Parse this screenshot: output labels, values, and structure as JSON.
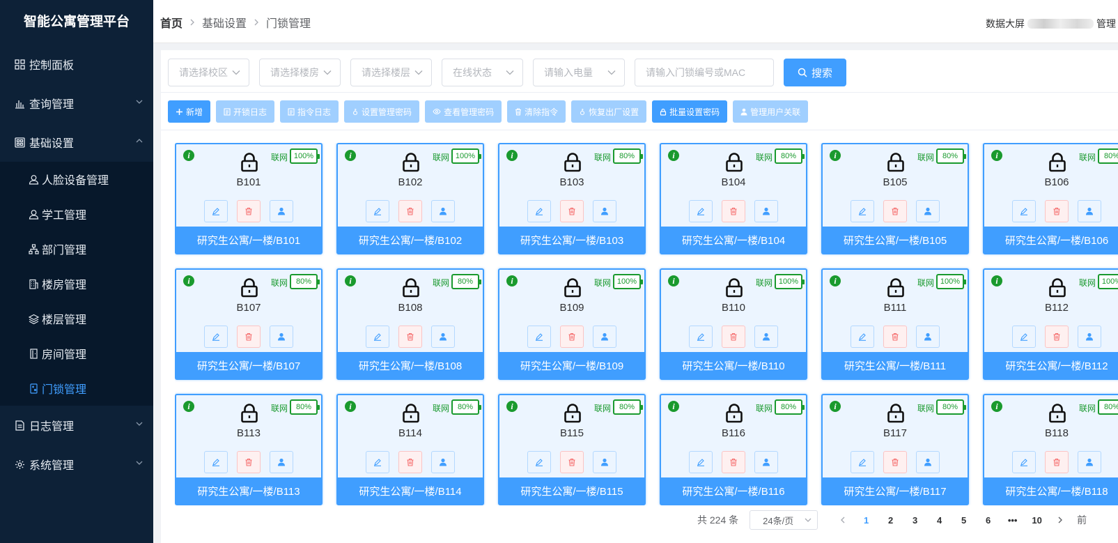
{
  "app": {
    "title": "智能公寓管理平台"
  },
  "sidebar": {
    "items": [
      {
        "label": "控制面板",
        "icon": "dashboard-icon"
      },
      {
        "label": "查询管理",
        "icon": "chart-icon",
        "expandable": true
      },
      {
        "label": "基础设置",
        "icon": "grid-icon",
        "expanded": true
      },
      {
        "label": "日志管理",
        "icon": "log-icon",
        "expandable": true
      },
      {
        "label": "系统管理",
        "icon": "gear-icon",
        "expandable": true
      }
    ],
    "sub_items": [
      {
        "label": "人脸设备管理",
        "icon": "face-icon"
      },
      {
        "label": "学工管理",
        "icon": "person-icon"
      },
      {
        "label": "部门管理",
        "icon": "org-icon"
      },
      {
        "label": "楼房管理",
        "icon": "building-icon"
      },
      {
        "label": "楼层管理",
        "icon": "layers-icon"
      },
      {
        "label": "房间管理",
        "icon": "door-icon"
      },
      {
        "label": "门锁管理",
        "icon": "lock-icon",
        "active": true
      }
    ]
  },
  "header": {
    "breadcrumb": [
      "首页",
      "基础设置",
      "门锁管理"
    ],
    "right": {
      "screen_label": "数据大屏",
      "admin_label": "管理"
    }
  },
  "filters": {
    "campus": "请选择校区",
    "building": "请选择楼房",
    "floor": "请选择楼层",
    "status": "在线状态",
    "battery": "请输入电量",
    "search_placeholder": "请输入门锁编号或MAC",
    "search_button": "搜索"
  },
  "toolbar": [
    {
      "label": "新增",
      "style": "primary",
      "icon": "plus-icon"
    },
    {
      "label": "开锁日志",
      "style": "plain",
      "icon": "doc-icon"
    },
    {
      "label": "指令日志",
      "style": "plain",
      "icon": "doc-icon"
    },
    {
      "label": "设置管理密码",
      "style": "plain",
      "icon": "key-icon"
    },
    {
      "label": "查看管理密码",
      "style": "plain",
      "icon": "eye-icon"
    },
    {
      "label": "清除指令",
      "style": "plain",
      "icon": "trash-icon"
    },
    {
      "label": "恢复出厂设置",
      "style": "plain",
      "icon": "key-icon"
    },
    {
      "label": "批量设置密码",
      "style": "primary",
      "icon": "lock-icon"
    },
    {
      "label": "管理用户关联",
      "style": "plain",
      "icon": "user-icon"
    }
  ],
  "locks": [
    {
      "code": "B101",
      "online": "联网",
      "battery": "100%",
      "location": "研究生公寓/一楼/B101"
    },
    {
      "code": "B102",
      "online": "联网",
      "battery": "100%",
      "location": "研究生公寓/一楼/B102"
    },
    {
      "code": "B103",
      "online": "联网",
      "battery": "80%",
      "location": "研究生公寓/一楼/B103"
    },
    {
      "code": "B104",
      "online": "联网",
      "battery": "80%",
      "location": "研究生公寓/一楼/B104"
    },
    {
      "code": "B105",
      "online": "联网",
      "battery": "80%",
      "location": "研究生公寓/一楼/B105"
    },
    {
      "code": "B106",
      "online": "联网",
      "battery": "80%",
      "location": "研究生公寓/一楼/B106"
    },
    {
      "code": "B107",
      "online": "联网",
      "battery": "80%",
      "location": "研究生公寓/一楼/B107"
    },
    {
      "code": "B108",
      "online": "联网",
      "battery": "80%",
      "location": "研究生公寓/一楼/B108"
    },
    {
      "code": "B109",
      "online": "联网",
      "battery": "100%",
      "location": "研究生公寓/一楼/B109"
    },
    {
      "code": "B110",
      "online": "联网",
      "battery": "100%",
      "location": "研究生公寓/一楼/B110"
    },
    {
      "code": "B111",
      "online": "联网",
      "battery": "100%",
      "location": "研究生公寓/一楼/B111"
    },
    {
      "code": "B112",
      "online": "联网",
      "battery": "100%",
      "location": "研究生公寓/一楼/B112"
    },
    {
      "code": "B113",
      "online": "联网",
      "battery": "80%",
      "location": "研究生公寓/一楼/B113"
    },
    {
      "code": "B114",
      "online": "联网",
      "battery": "80%",
      "location": "研究生公寓/一楼/B114"
    },
    {
      "code": "B115",
      "online": "联网",
      "battery": "80%",
      "location": "研究生公寓/一楼/B115"
    },
    {
      "code": "B116",
      "online": "联网",
      "battery": "80%",
      "location": "研究生公寓/一楼/B116"
    },
    {
      "code": "B117",
      "online": "联网",
      "battery": "80%",
      "location": "研究生公寓/一楼/B117"
    },
    {
      "code": "B118",
      "online": "联网",
      "battery": "80%",
      "location": "研究生公寓/一楼/B118"
    }
  ],
  "pagination": {
    "total": "共 224 条",
    "page_size": "24条/页",
    "pages": [
      "1",
      "2",
      "3",
      "4",
      "5",
      "6",
      "•••",
      "10"
    ],
    "current": "1",
    "jump_label": "前"
  },
  "colors": {
    "sidebar_bg": "#0d2137",
    "accent": "#409eff",
    "online_green": "#1a9a2e",
    "danger": "#f56c6c"
  }
}
